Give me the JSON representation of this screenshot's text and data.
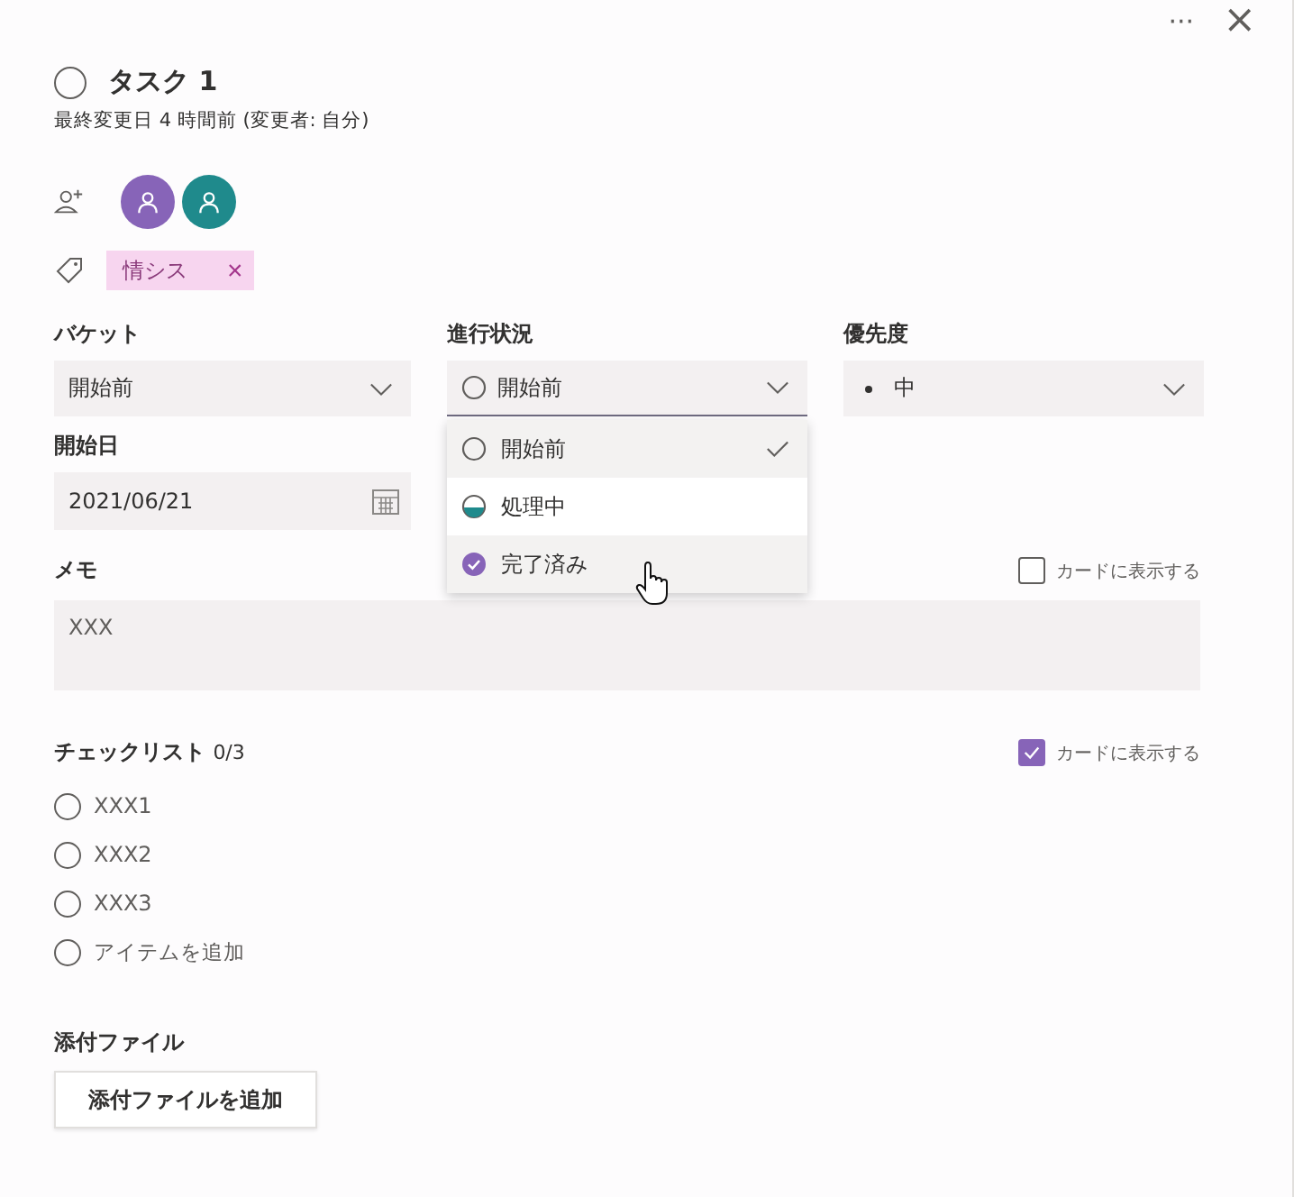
{
  "header": {
    "more": "···",
    "close": "×"
  },
  "task": {
    "title": "タスク 1",
    "completed": false,
    "modified": "最終変更日 4 時間前 (変更者: 自分)"
  },
  "assignees": [
    {
      "color": "#8764b8"
    },
    {
      "color": "#1f8a8c"
    }
  ],
  "labels": [
    {
      "text": "情シス",
      "remove": "×"
    }
  ],
  "fields": [
    {
      "label": "バケット",
      "value": "開始前"
    },
    {
      "label": "進行状況",
      "value": "開始前",
      "kind": "not_started",
      "open": true
    },
    {
      "label": "優先度",
      "value": "中"
    }
  ],
  "status_menu": [
    {
      "label": "開始前",
      "kind": "not_started",
      "selected": true,
      "hovered": false
    },
    {
      "label": "処理中",
      "kind": "in_progress",
      "selected": false,
      "hovered": false
    },
    {
      "label": "完了済み",
      "kind": "completed",
      "selected": false,
      "hovered": true
    }
  ],
  "start_date": {
    "label": "開始日",
    "value": "2021/06/21"
  },
  "notes": {
    "label": "メモ",
    "show_on_card": {
      "label": "カードに表示する",
      "checked": false
    },
    "value": "XXX"
  },
  "checklist": {
    "label": "チェックリスト",
    "count": "0/3",
    "show_on_card": {
      "label": "カードに表示する",
      "checked": true
    },
    "items": [
      {
        "text": "XXX1",
        "checked": false
      },
      {
        "text": "XXX2",
        "checked": false
      },
      {
        "text": "XXX3",
        "checked": false
      }
    ],
    "add_placeholder": "アイテムを追加"
  },
  "attachments": {
    "label": "添付ファイル",
    "button": "添付ファイルを追加"
  }
}
